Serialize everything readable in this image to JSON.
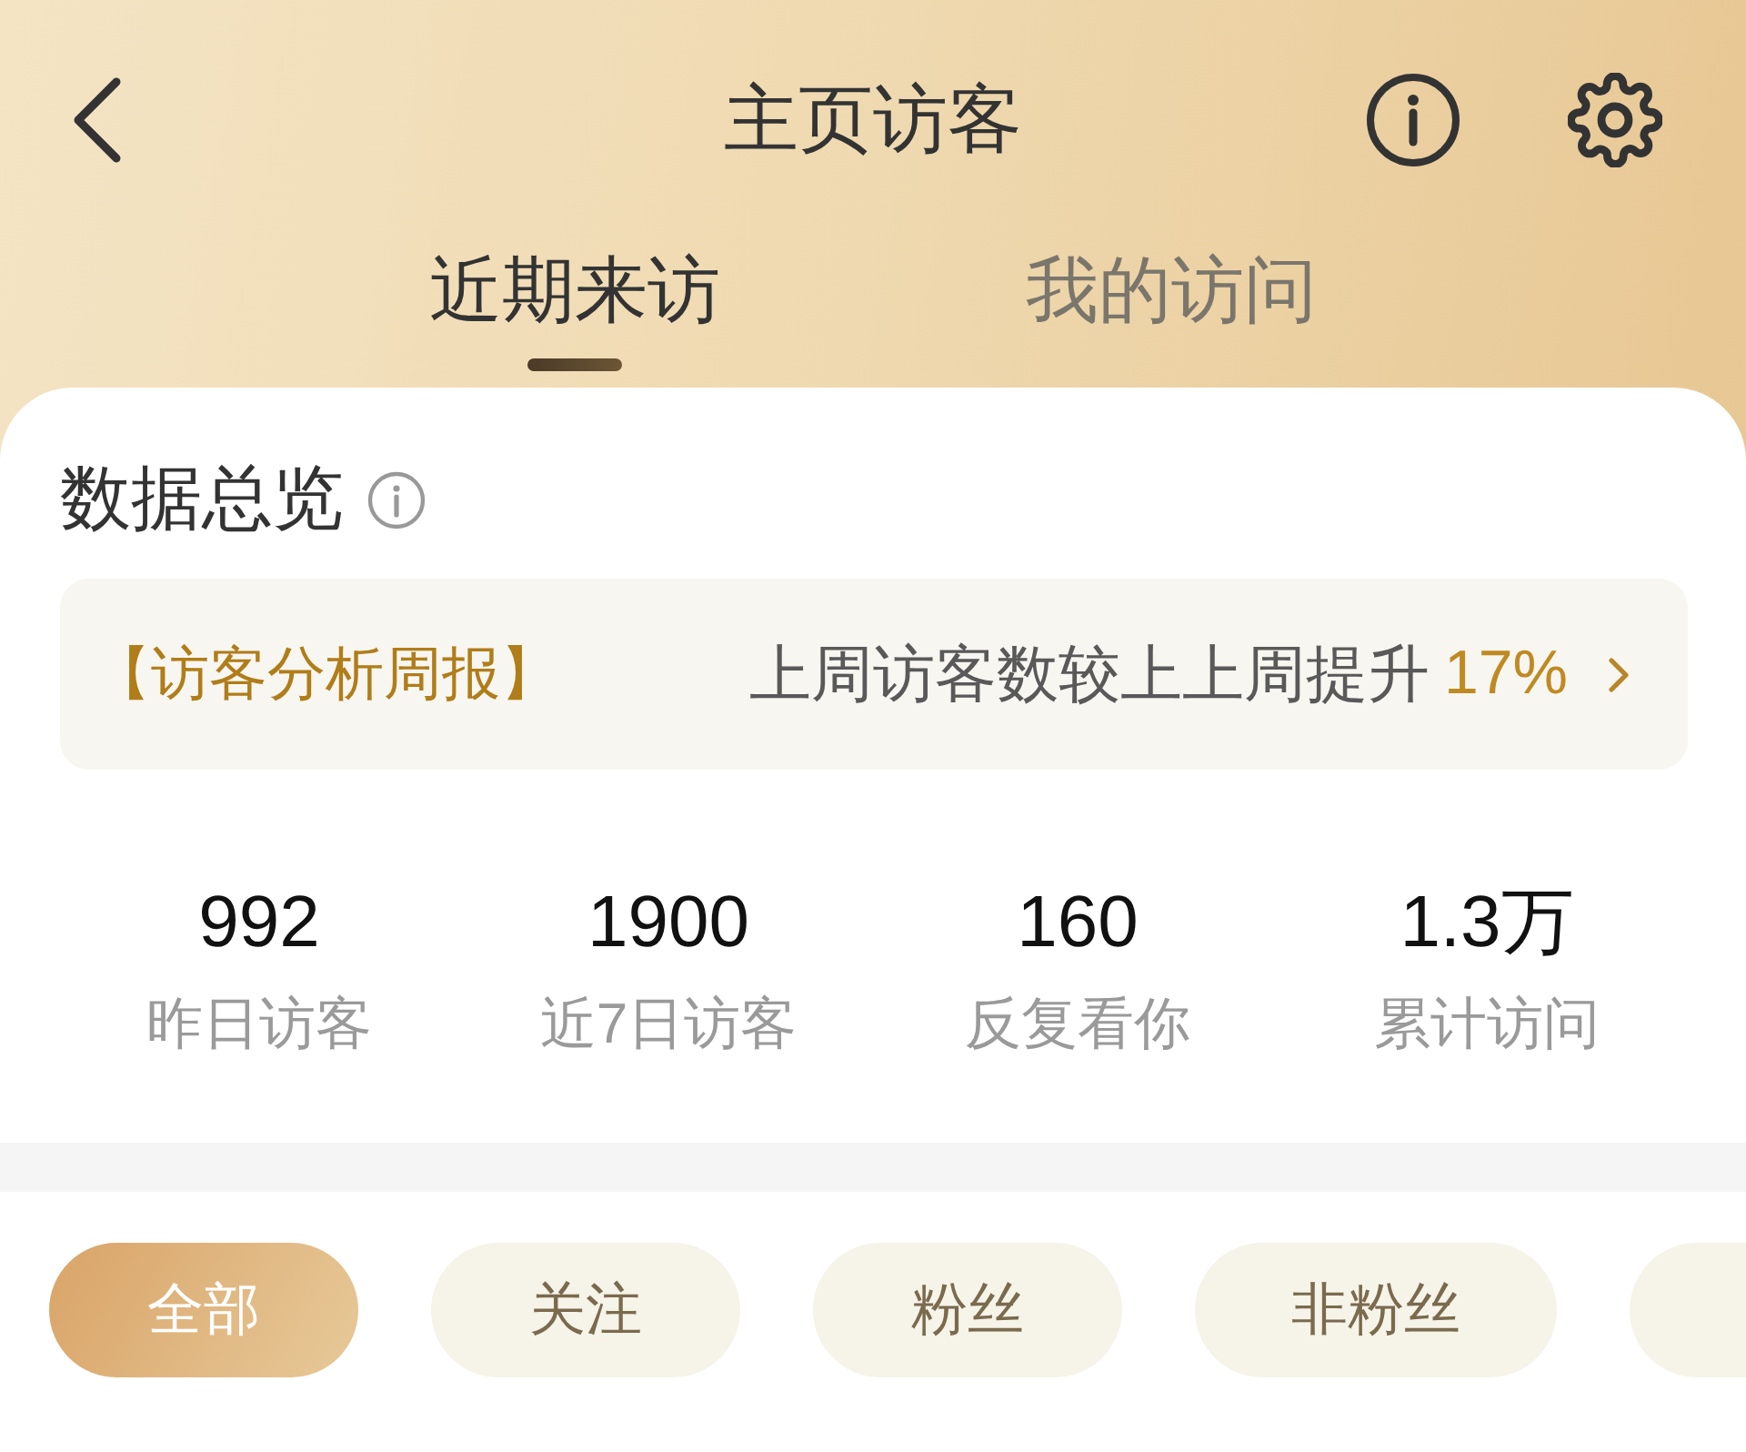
{
  "header": {
    "title": "主页访客"
  },
  "tabs": [
    {
      "label": "近期来访",
      "selected": true
    },
    {
      "label": "我的访问",
      "selected": false
    }
  ],
  "overview": {
    "title": "数据总览",
    "report": {
      "tag": "【访客分析周报】",
      "text": "上周访客数较上上周提升",
      "change": "17%"
    },
    "stats": [
      {
        "value": "992",
        "label": "昨日访客"
      },
      {
        "value": "1900",
        "label": "近7日访客"
      },
      {
        "value": "160",
        "label": "反复看你"
      },
      {
        "value": "1.3万",
        "label": "累计访问"
      }
    ]
  },
  "filters": [
    {
      "label": "全部",
      "selected": true
    },
    {
      "label": "关注",
      "selected": false
    },
    {
      "label": "粉丝",
      "selected": false
    },
    {
      "label": "非粉丝",
      "selected": false
    },
    {
      "selected": false
    }
  ]
}
